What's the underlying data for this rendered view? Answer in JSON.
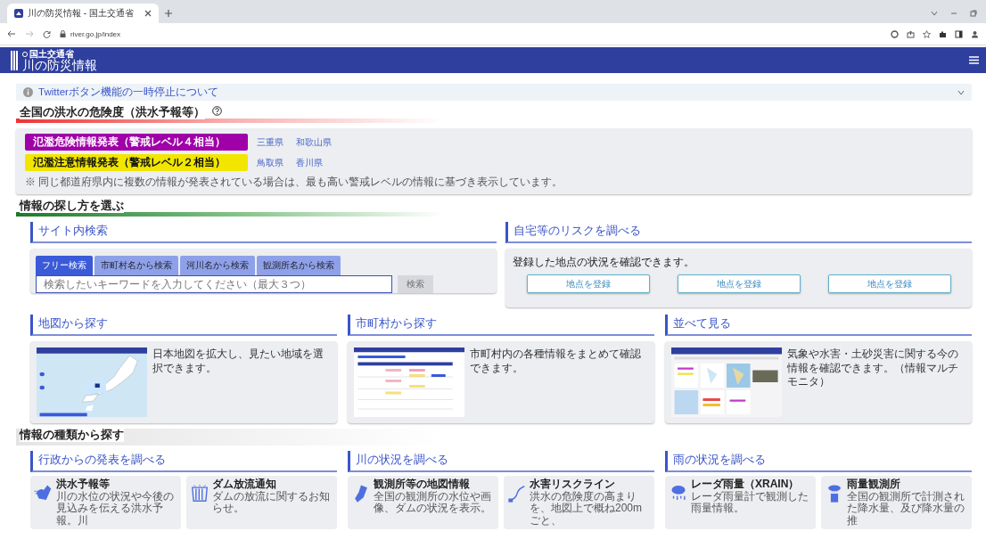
{
  "browser": {
    "tab_title": "川の防災情報 - 国土交通省",
    "url": "river.go.jp/index"
  },
  "header": {
    "ministry": "国土交通省",
    "title": "川の防災情報"
  },
  "notice": {
    "text": "Twitterボタン機能の一時停止について",
    "expanded": false
  },
  "danger": {
    "heading": "全国の洪水の危険度（洪水予報等）",
    "levels": [
      {
        "label": "氾濫危険情報発表（警戒レベル４相当）",
        "color": "#a000a8",
        "prefectures": [
          "三重県",
          "和歌山県"
        ]
      },
      {
        "label": "氾濫注意情報発表（警戒レベル２相当）",
        "color": "#f2e600",
        "prefectures": [
          "鳥取県",
          "香川県"
        ]
      }
    ],
    "note": "※ 同じ都道府県内に複数の情報が発表されている場合は、最も高い警戒レベルの情報に基づき表示しています。"
  },
  "find": {
    "heading": "情報の探し方を選ぶ",
    "search": {
      "title": "サイト内検索",
      "tabs": [
        {
          "label": "フリー検索",
          "selected": true
        },
        {
          "label": "市町村名から検索",
          "selected": false
        },
        {
          "label": "河川名から検索",
          "selected": false
        },
        {
          "label": "観測所名から検索",
          "selected": false
        }
      ],
      "placeholder": "検索したいキーワードを入力してください（最大３つ）",
      "button": "検索",
      "button_disabled": true
    },
    "risk": {
      "title": "自宅等のリスクを調べる",
      "text": "登録した地点の状況を確認できます。",
      "buttons": [
        "地点を登録",
        "地点を登録",
        "地点を登録"
      ]
    },
    "cards": [
      {
        "title": "地図から探す",
        "text": "日本地図を拡大し、見たい地域を選択できます。",
        "kind": "map"
      },
      {
        "title": "市町村から探す",
        "text": "市町村内の各種情報をまとめて確認できます。",
        "kind": "table"
      },
      {
        "title": "並べて見る",
        "text": "気象や水害・土砂災害に関する今の情報を確認できます。（情報マルチモニタ）",
        "kind": "dashboard"
      }
    ]
  },
  "types": {
    "heading": "情報の種類から探す",
    "groups": [
      {
        "title": "行政からの発表を調べる",
        "items": [
          {
            "title": "洪水予報等",
            "text": "川の水位の状況や今後の見込みを伝える洪水予報。川"
          },
          {
            "title": "ダム放流通知",
            "text": "ダムの放流に関するお知らせ。"
          }
        ]
      },
      {
        "title": "川の状況を調べる",
        "items": [
          {
            "title": "観測所等の地図情報",
            "text": "全国の観測所の水位や画像、ダムの状況を表示。"
          },
          {
            "title": "水害リスクライン",
            "text": "洪水の危険度の高まりを、地図上で概ね200mごと、"
          }
        ]
      },
      {
        "title": "雨の状況を調べる",
        "items": [
          {
            "title": "レーダ雨量（XRAIN）",
            "text": "レーダ雨量計で観測した雨量情報。"
          },
          {
            "title": "雨量観測所",
            "text": "全国の観測所で計測された降水量、及び降水量の推"
          }
        ]
      }
    ]
  }
}
